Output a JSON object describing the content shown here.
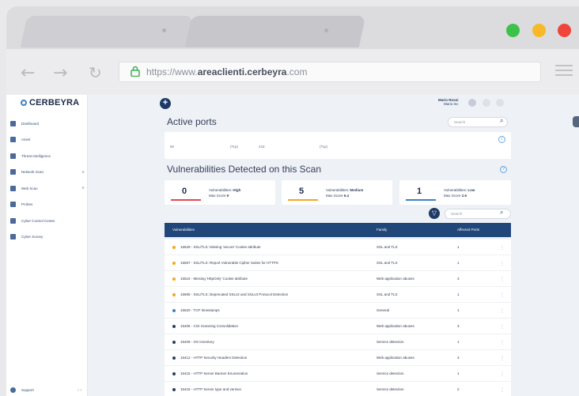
{
  "browser": {
    "url_prefix": "https://www.",
    "url_domain": "areaclienti.cerbeyra",
    "url_suffix": ".com"
  },
  "sidebar": {
    "brand": "CERBEYRA",
    "items": [
      {
        "label": "Dashboard",
        "icon": "dashboard-icon"
      },
      {
        "label": "Asset",
        "icon": "asset-icon"
      },
      {
        "label": "Threat Intelligence",
        "icon": "threat-icon"
      },
      {
        "label": "Network Scan",
        "icon": "network-icon",
        "chevron": "∨"
      },
      {
        "label": "Web Scan",
        "icon": "web-icon",
        "chevron": "∨"
      },
      {
        "label": "Probes",
        "icon": "probe-icon"
      },
      {
        "label": "Cyber Control Center",
        "icon": "control-icon"
      },
      {
        "label": "Cyber Survey",
        "icon": "survey-icon"
      }
    ],
    "support_label": "Support"
  },
  "topbar": {
    "user_name": "Mario Rossi",
    "user_role": "Mario Inc"
  },
  "ports": {
    "title": "Active ports",
    "search_placeholder": "Search",
    "cells": [
      "80",
      "(Tcp)",
      "443",
      "(Tcp)"
    ]
  },
  "vulns": {
    "title": "Vulnerabilities Detected on this Scan",
    "cards": [
      {
        "count": "0",
        "label": "Vulnerabilities: ",
        "level": "High",
        "score_label": "Max Score ",
        "score": "9",
        "color": "#e5484d"
      },
      {
        "count": "5",
        "label": "Vulnerabilities: ",
        "level": "Medium",
        "score_label": "Max Score ",
        "score": "6.4",
        "color": "#f5a623"
      },
      {
        "count": "1",
        "label": "Vulnerabilities: ",
        "level": "Low",
        "score_label": "Max Score ",
        "score": "2.6",
        "color": "#3b82c4"
      }
    ],
    "search_placeholder": "Search"
  },
  "table": {
    "headers": [
      "Vulnerabilities",
      "Family",
      "Affected Ports"
    ],
    "rows": [
      {
        "name": "15529 - SSL/TLS: Missing 'secure' Cookie attribute",
        "family": "SSL and TLS",
        "ports": "1",
        "color": "#f5a623"
      },
      {
        "name": "15597 - SSL/TLS: Report Vulnerable Cipher Suites for HTTPS",
        "family": "SSL and TLS",
        "ports": "1",
        "color": "#f5a623"
      },
      {
        "name": "15516 - Missing 'HttpOnly' Cookie attribute",
        "family": "Web application abuses",
        "ports": "3",
        "color": "#f5a623"
      },
      {
        "name": "15595 - SSL/TLS: Deprecated SSLv2 and SSLv3 Protocol Detection",
        "family": "SSL and TLS",
        "ports": "1",
        "color": "#f5a623"
      },
      {
        "name": "15620 - TCP timestamps",
        "family": "General",
        "ports": "1",
        "color": "#3b82c4"
      },
      {
        "name": "15406 - CGI Scanning Consolidation",
        "family": "Web application abuses",
        "ports": "3",
        "color": "#2a3e62"
      },
      {
        "name": "15409 - OS Inventory",
        "family": "Service detection",
        "ports": "1",
        "color": "#2a3e62"
      },
      {
        "name": "15412 - HTTP Security Headers Detection",
        "family": "Web application abuses",
        "ports": "3",
        "color": "#2a3e62"
      },
      {
        "name": "15415 - HTTP Server Banner Enumeration",
        "family": "Service detection",
        "ports": "1",
        "color": "#2a3e62"
      },
      {
        "name": "15416 - HTTP Server type and version",
        "family": "Service detection",
        "ports": "2",
        "color": "#2a3e62"
      }
    ]
  }
}
